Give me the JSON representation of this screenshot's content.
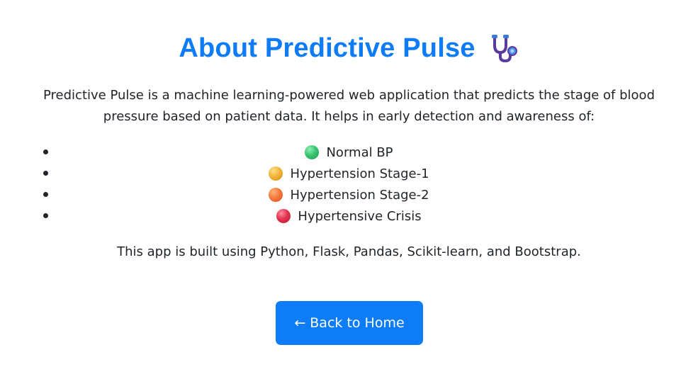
{
  "header": {
    "title": "About Predictive Pulse",
    "icon": "stethoscope-icon"
  },
  "intro": "Predictive Pulse is a machine learning-powered web application that predicts the stage of blood pressure based on patient data. It helps in early detection and awareness of:",
  "stages": [
    {
      "label": "Normal BP",
      "icon": "green-circle-icon",
      "color": "#39c472"
    },
    {
      "label": "Hypertension Stage-1",
      "icon": "yellow-circle-icon",
      "color": "#f2b53a"
    },
    {
      "label": "Hypertension Stage-2",
      "icon": "orange-circle-icon",
      "color": "#f47b3b"
    },
    {
      "label": "Hypertensive Crisis",
      "icon": "red-circle-icon",
      "color": "#e2334f"
    }
  ],
  "footer_text": "This app is built using Python, Flask, Pandas, Scikit-learn, and Bootstrap.",
  "back_button": {
    "label": "← Back to Home"
  },
  "colors": {
    "accent": "#0d7cf6",
    "text": "#212529"
  }
}
